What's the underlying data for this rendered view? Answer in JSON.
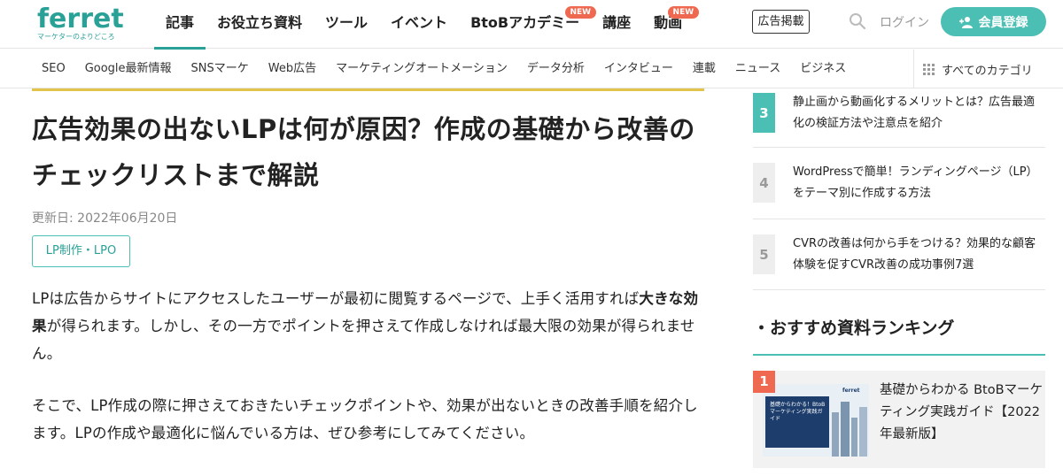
{
  "header": {
    "logo": "ferret",
    "logo_tagline": "マーケターのよりどころ",
    "nav": [
      {
        "label": "記事",
        "badge": ""
      },
      {
        "label": "お役立ち資料",
        "badge": ""
      },
      {
        "label": "ツール",
        "badge": ""
      },
      {
        "label": "イベント",
        "badge": ""
      },
      {
        "label": "BtoBアカデミー",
        "badge": "NEW"
      },
      {
        "label": "講座",
        "badge": ""
      },
      {
        "label": "動画",
        "badge": "NEW"
      }
    ],
    "ad_button": "広告掲載",
    "login": "ログイン",
    "register": "会員登録"
  },
  "subnav": {
    "items": [
      "SEO",
      "Google最新情報",
      "SNSマーケ",
      "Web広告",
      "マーケティングオートメーション",
      "データ分析",
      "インタビュー",
      "連載",
      "ニュース",
      "ビジネス"
    ],
    "all_categories": "すべてのカテゴリ"
  },
  "article": {
    "title": "広告効果の出ないLPは何が原因？作成の基礎から改善のチェックリストまで解説",
    "updated": "更新日: 2022年06月20日",
    "tag": "LP制作・LPO",
    "p1_before": "LPは広告からサイトにアクセスしたユーザーが最初に閲覧するページで、上手く活用すれば",
    "p1_bold": "大きな効果",
    "p1_after": "が得られます。しかし、その一方でポイントを押さえて作成しなければ最大限の効果が得られません。",
    "p2": "そこで、LP作成の際に押さえておきたいチェックポイントや、効果が出ないときの改善手順を紹介します。LPの作成や最適化に悩んでいる方は、ぜひ参考にしてみてください。"
  },
  "sidebar": {
    "ranking": [
      {
        "num": "3",
        "text": "静止画から動画化するメリットとは？広告最適化の検証方法や注意点を紹介"
      },
      {
        "num": "4",
        "text": "WordPressで簡単！ランディングページ（LP）をテーマ別に作成する方法"
      },
      {
        "num": "5",
        "text": "CVRの改善は何から手をつける？効果的な顧客体験を促すCVR改善の成功事例7選"
      }
    ],
    "recommend_heading": "・おすすめ資料ランキング",
    "recommend": [
      {
        "num": "1",
        "title": "基礎からわかる BtoBマーケティング実践ガイド【2022年最新版】",
        "thumb_brand": "ferret",
        "thumb_text": "基礎からわかる！BtoBマーケティング実践ガイド"
      }
    ]
  },
  "colors": {
    "brand": "#2aa197",
    "accent": "#4cbfb5",
    "new_badge": "#ef6950",
    "title_rule": "#e3c44b"
  }
}
